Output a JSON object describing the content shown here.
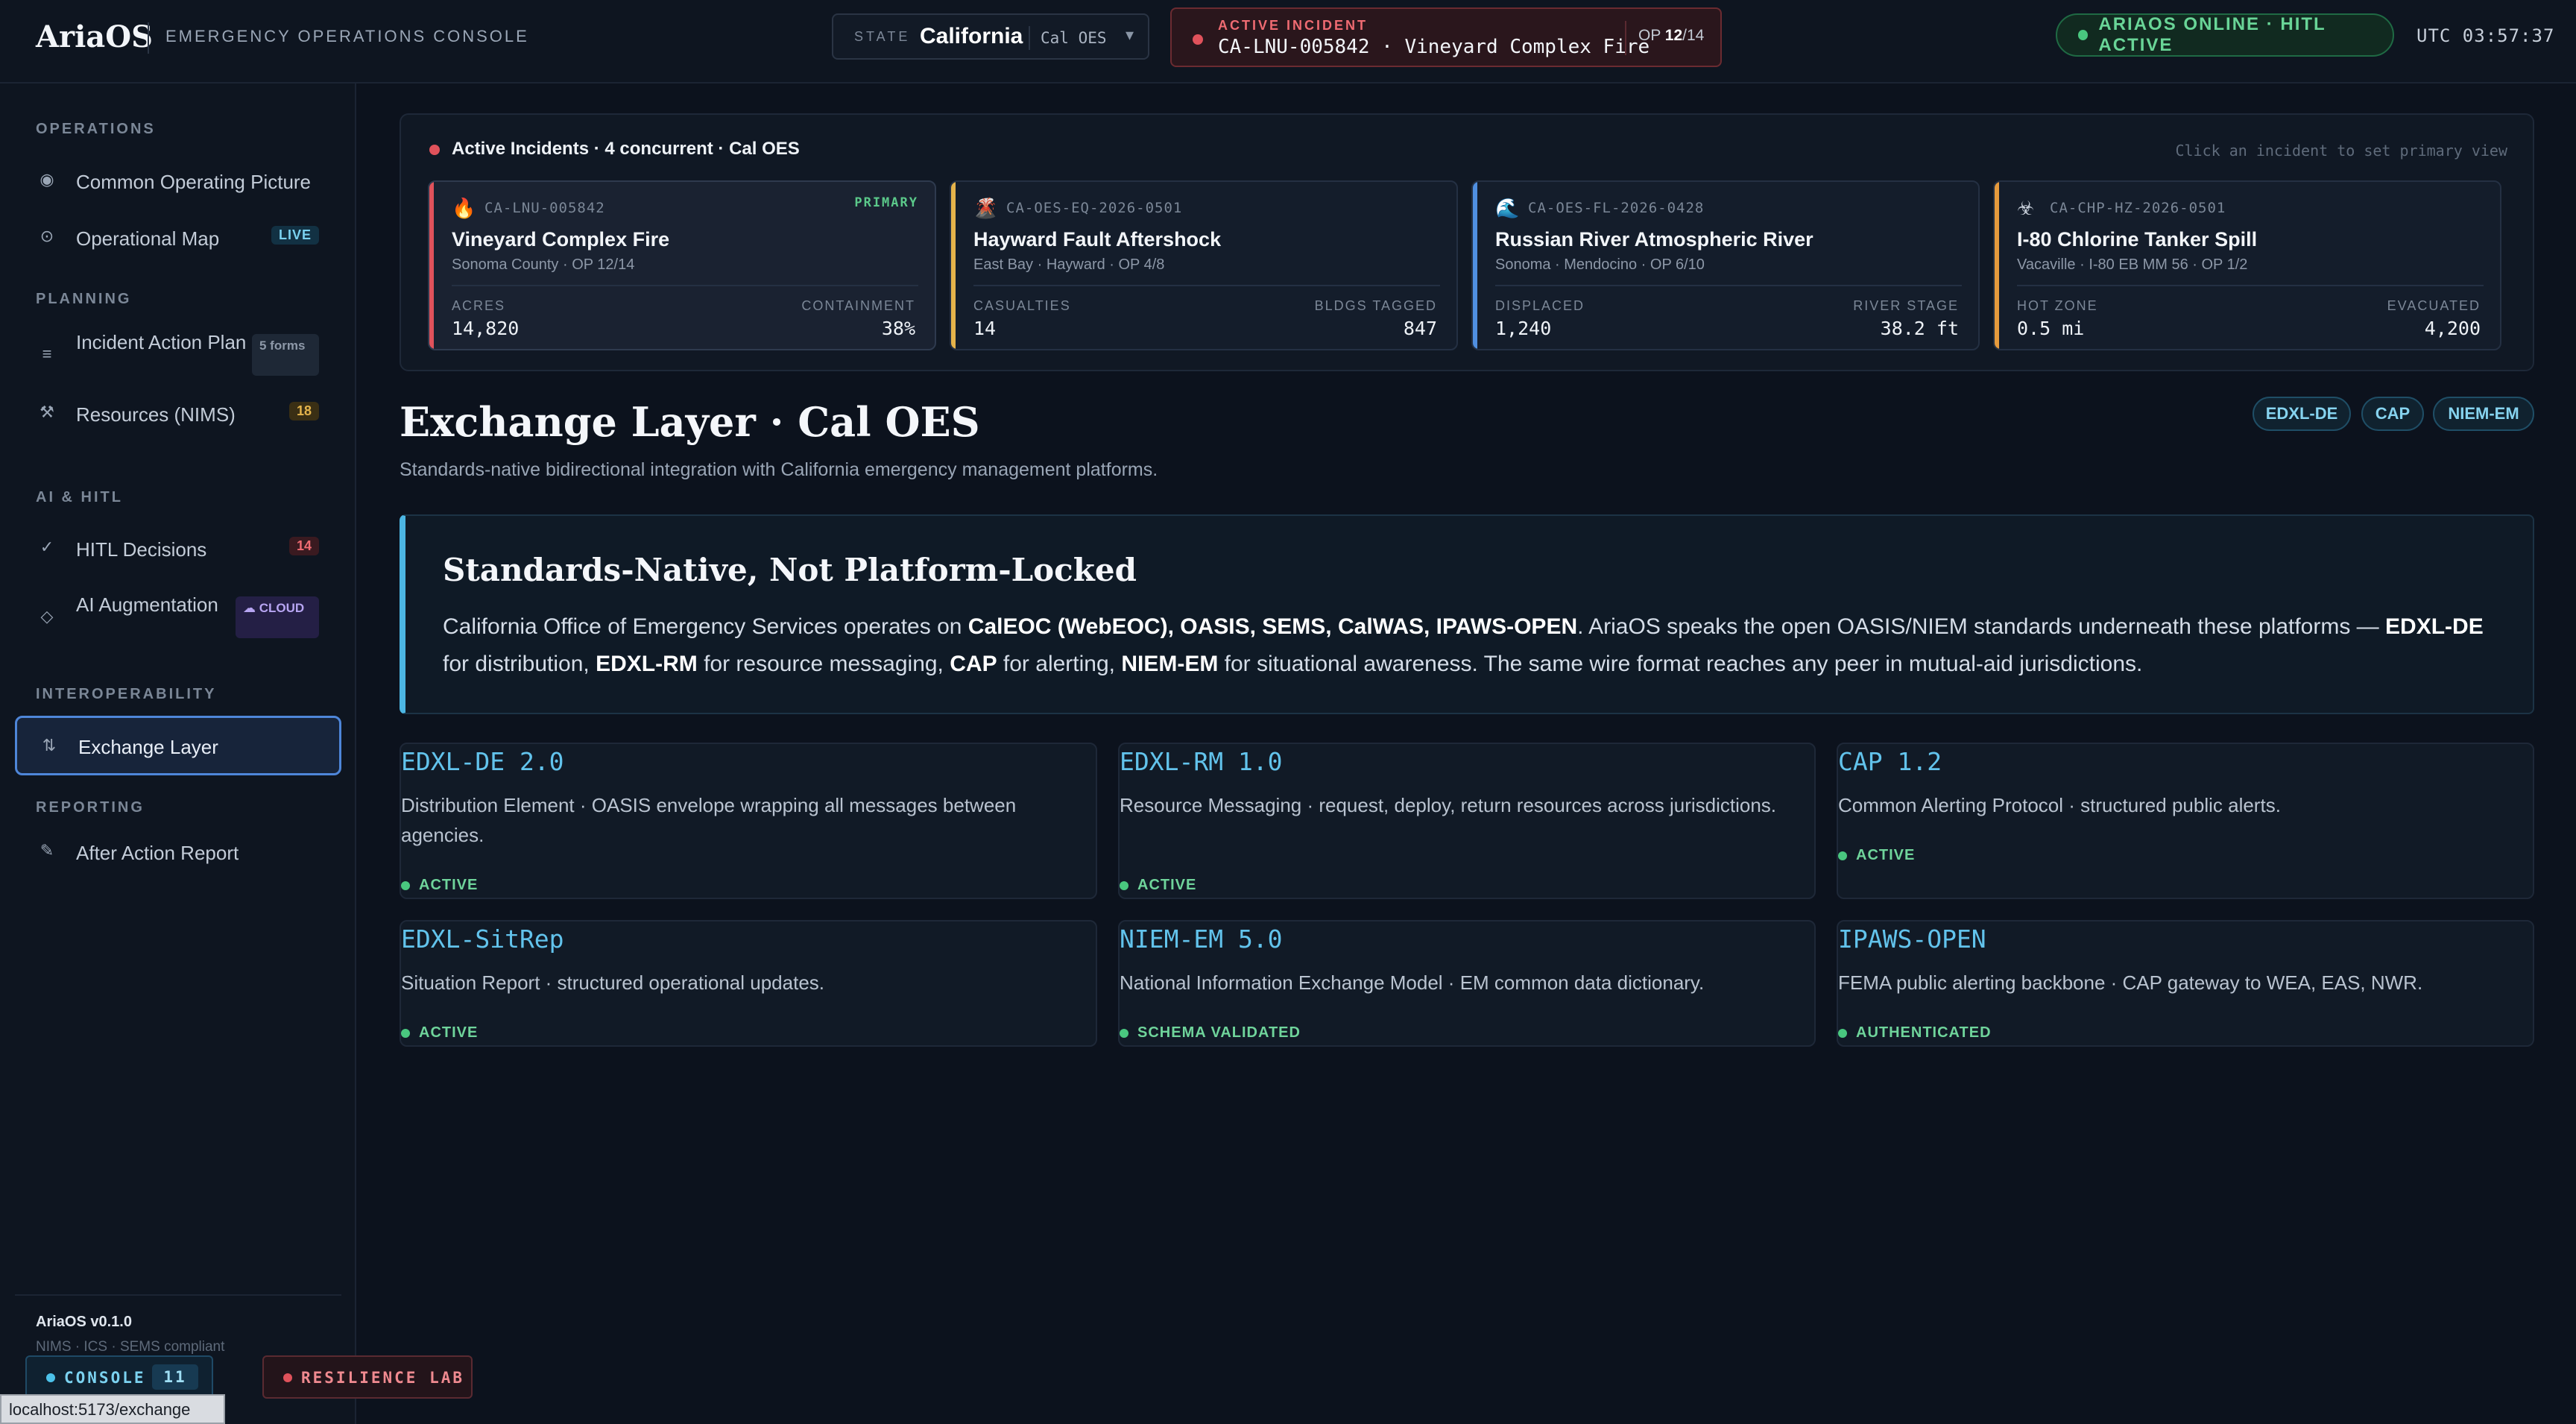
{
  "topbar": {
    "brand": "AriaOS",
    "console_title": "EMERGENCY OPERATIONS CONSOLE",
    "state_label": "STATE",
    "state_value": "California",
    "agency": "Cal OES",
    "caret": "▾",
    "incident_label": "ACTIVE INCIDENT",
    "incident_name": "CA-LNU-005842 · Vineyard Complex Fire",
    "op_prefix": "OP ",
    "op_current": "12",
    "op_total": "/14",
    "online_status": "ARIAOS ONLINE · HITL ACTIVE",
    "utc": "UTC 03:57:37"
  },
  "sidebar": {
    "sections": {
      "operations": "OPERATIONS",
      "planning": "PLANNING",
      "ai_hitl": "AI & HITL",
      "interoperability": "INTEROPERABILITY",
      "reporting": "REPORTING"
    },
    "items": {
      "cop": {
        "label": "Common Operating Picture",
        "icon": "target-icon",
        "glyph": "◉"
      },
      "map": {
        "label": "Operational Map",
        "badge": "LIVE",
        "icon": "location-icon",
        "glyph": "⊙"
      },
      "iap": {
        "label": "Incident Action Plan",
        "badge": "5 forms",
        "icon": "list-icon",
        "glyph": "≡"
      },
      "resources": {
        "label": "Resources (NIMS)",
        "badge": "18",
        "icon": "tools-icon",
        "glyph": "⚒"
      },
      "hitl": {
        "label": "HITL Decisions",
        "badge": "14",
        "icon": "check-icon",
        "glyph": "✓"
      },
      "ai": {
        "label": "AI Augmentation",
        "badge": "☁ CLOUD",
        "icon": "diamond-icon",
        "glyph": "◇"
      },
      "exchange": {
        "label": "Exchange Layer",
        "icon": "swap-icon",
        "glyph": "⇅"
      },
      "aar": {
        "label": "After Action Report",
        "icon": "pencil-icon",
        "glyph": "✎"
      }
    },
    "version": "AriaOS v0.1.0",
    "compliance": "NIMS · ICS · SEMS compliant",
    "console_label": "CONSOLE",
    "console_count": "11",
    "lab_label": "RESILIENCE LAB",
    "status_url": "localhost:5173/exchange"
  },
  "incidents": {
    "header": "Active Incidents · 4 concurrent · Cal OES",
    "hint": "Click an incident to set primary view",
    "cards": [
      {
        "emoji": "🔥",
        "code": "CA-LNU-005842",
        "tag": "PRIMARY",
        "name": "Vineyard Complex Fire",
        "location": "Sonoma County · OP 12/14",
        "k1": "ACRES",
        "v1": "14,820",
        "k2": "CONTAINMENT",
        "v2": "38%",
        "accent": "#e0525b"
      },
      {
        "emoji": "🌋",
        "code": "CA-OES-EQ-2026-0501",
        "tag": "",
        "name": "Hayward Fault Aftershock",
        "location": "East Bay · Hayward · OP 4/8",
        "k1": "CASUALTIES",
        "v1": "14",
        "k2": "BLDGS TAGGED",
        "v2": "847",
        "accent": "#e5b34a"
      },
      {
        "emoji": "🌊",
        "code": "CA-OES-FL-2026-0428",
        "tag": "",
        "name": "Russian River Atmospheric River",
        "location": "Sonoma · Mendocino · OP 6/10",
        "k1": "DISPLACED",
        "v1": "1,240",
        "k2": "RIVER STAGE",
        "v2": "38.2 ft",
        "accent": "#4f8fe0"
      },
      {
        "emoji": "☣",
        "code": "CA-CHP-HZ-2026-0501",
        "tag": "",
        "name": "I-80 Chlorine Tanker Spill",
        "location": "Vacaville · I-80 EB MM 56 · OP 1/2",
        "k1": "HOT ZONE",
        "v1": "0.5 mi",
        "k2": "EVACUATED",
        "v2": "4,200",
        "accent": "#e59a3c"
      }
    ]
  },
  "main": {
    "title": "Exchange Layer · Cal OES",
    "subtitle": "Standards-native bidirectional integration with California emergency management platforms.",
    "pills": [
      "EDXL-DE",
      "CAP",
      "NIEM-EM"
    ],
    "callout_title": "Standards-Native, Not Platform-Locked",
    "callout_parts": {
      "p1": "California Office of Emergency Services operates on ",
      "b1": "CalEOC (WebEOC), OASIS, SEMS, CalWAS, IPAWS-OPEN",
      "p2": ". AriaOS speaks the open OASIS/NIEM standards underneath these platforms — ",
      "b2": "EDXL-DE",
      "p3": " for distribution, ",
      "b3": "EDXL-RM",
      "p4": " for resource messaging, ",
      "b4": "CAP",
      "p5": " for alerting, ",
      "b5": "NIEM-EM",
      "p6": " for situational awareness. The same wire format reaches any peer in mutual-aid jurisdictions."
    },
    "standards": [
      {
        "name": "EDXL-DE 2.0",
        "desc": "Distribution Element · OASIS envelope wrapping all messages between agencies.",
        "status": "ACTIVE"
      },
      {
        "name": "EDXL-RM 1.0",
        "desc": "Resource Messaging · request, deploy, return resources across jurisdictions.",
        "status": "ACTIVE"
      },
      {
        "name": "CAP 1.2",
        "desc": "Common Alerting Protocol · structured public alerts.",
        "status": "ACTIVE"
      },
      {
        "name": "EDXL-SitRep",
        "desc": "Situation Report · structured operational updates.",
        "status": "ACTIVE"
      },
      {
        "name": "NIEM-EM 5.0",
        "desc": "National Information Exchange Model · EM common data dictionary.",
        "status": "SCHEMA VALIDATED"
      },
      {
        "name": "IPAWS-OPEN",
        "desc": "FEMA public alerting backbone · CAP gateway to WEA, EAS, NWR.",
        "status": "AUTHENTICATED"
      }
    ]
  }
}
